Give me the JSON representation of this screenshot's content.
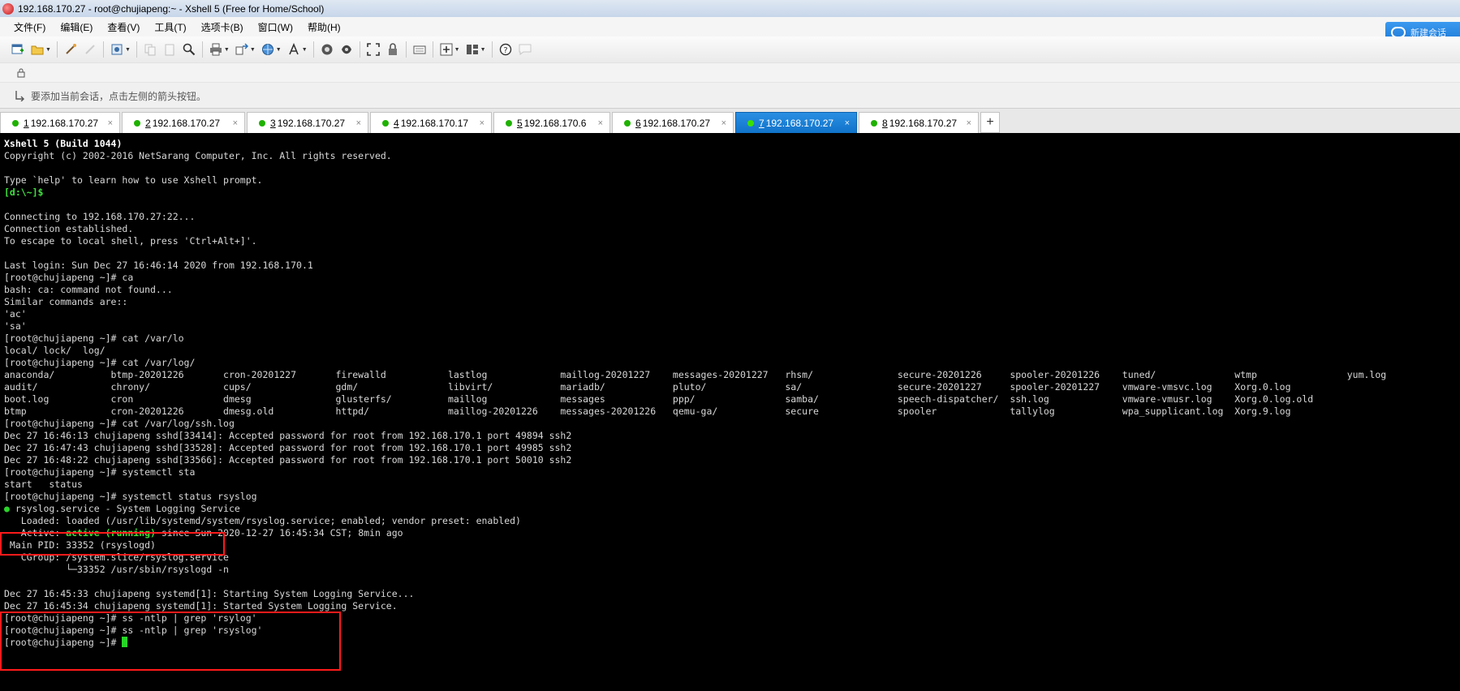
{
  "window": {
    "title": "192.168.170.27 - root@chujiapeng:~ - Xshell 5 (Free for Home/School)"
  },
  "menu": [
    "文件(F)",
    "编辑(E)",
    "查看(V)",
    "工具(T)",
    "选项卡(B)",
    "窗口(W)",
    "帮助(H)"
  ],
  "cloud_badge": "新建会话",
  "hint": "要添加当前会话，点击左侧的箭头按钮。",
  "tabs": [
    {
      "num": "1",
      "ip": "192.168.170.27",
      "active": false
    },
    {
      "num": "2",
      "ip": "192.168.170.27",
      "active": false
    },
    {
      "num": "3",
      "ip": "192.168.170.27",
      "active": false
    },
    {
      "num": "4",
      "ip": "192.168.170.17",
      "active": false
    },
    {
      "num": "5",
      "ip": "192.168.170.6",
      "active": false
    },
    {
      "num": "6",
      "ip": "192.168.170.27",
      "active": false
    },
    {
      "num": "7",
      "ip": "192.168.170.27",
      "active": true
    },
    {
      "num": "8",
      "ip": "192.168.170.27",
      "active": false
    }
  ],
  "tab_add": "+",
  "tab_close": "×",
  "terminal": {
    "l01": "Xshell 5 (Build 1044)",
    "l02": "Copyright (c) 2002-2016 NetSarang Computer, Inc. All rights reserved.",
    "l03": "",
    "l04": "Type `help' to learn how to use Xshell prompt.",
    "l05": "[d:\\~]$",
    "l06": "",
    "l07": "Connecting to 192.168.170.27:22...",
    "l08": "Connection established.",
    "l09": "To escape to local shell, press 'Ctrl+Alt+]'.",
    "l10": "",
    "l11": "Last login: Sun Dec 27 16:46:14 2020 from 192.168.170.1",
    "l12": "[root@chujiapeng ~]# ca",
    "l13": "bash: ca: command not found...",
    "l14": "Similar commands are::",
    "l15": "'ac'",
    "l16": "'sa'",
    "l17": "[root@chujiapeng ~]# cat /var/lo",
    "l18": "local/ lock/  log/",
    "l19": "[root@chujiapeng ~]# cat /var/log/",
    "l20": "anaconda/          btmp-20201226       cron-20201227       firewalld           lastlog             maillog-20201227    messages-20201227   rhsm/               secure-20201226     spooler-20201226    tuned/              wtmp                yum.log",
    "l21": "audit/             chrony/             cups/               gdm/                libvirt/            mariadb/            pluto/              sa/                 secure-20201227     spooler-20201227    vmware-vmsvc.log    Xorg.0.log",
    "l22": "boot.log           cron                dmesg               glusterfs/          maillog             messages            ppp/                samba/              speech-dispatcher/  ssh.log             vmware-vmusr.log    Xorg.0.log.old",
    "l23": "btmp               cron-20201226       dmesg.old           httpd/              maillog-20201226    messages-20201226   qemu-ga/            secure              spooler             tallylog            wpa_supplicant.log  Xorg.9.log",
    "l24": "[root@chujiapeng ~]# cat /var/log/ssh.log",
    "l25": "Dec 27 16:46:13 chujiapeng sshd[33414]: Accepted password for root from 192.168.170.1 port 49894 ssh2",
    "l26": "Dec 27 16:47:43 chujiapeng sshd[33528]: Accepted password for root from 192.168.170.1 port 49985 ssh2",
    "l27": "Dec 27 16:48:22 chujiapeng sshd[33566]: Accepted password for root from 192.168.170.1 port 50010 ssh2",
    "l28": "[root@chujiapeng ~]# systemctl sta",
    "l29": "start   status",
    "l30": "[root@chujiapeng ~]# systemctl status rsyslog",
    "l31_dot": "●",
    "l31": " rsyslog.service - System Logging Service",
    "l32": "   Loaded: loaded (/usr/lib/systemd/system/rsyslog.service; enabled; vendor preset: enabled)",
    "l33a": "   Active: ",
    "l33b": "active (running)",
    "l33c": " since Sun 2020-12-27 16:45:34 CST; 8min ago",
    "l34": " Main PID: 33352 (rsyslogd)",
    "l35": "   CGroup: /system.slice/rsyslog.service",
    "l36": "           └─33352 /usr/sbin/rsyslogd -n",
    "l37": "",
    "l38": "Dec 27 16:45:33 chujiapeng systemd[1]: Starting System Logging Service...",
    "l39": "Dec 27 16:45:34 chujiapeng systemd[1]: Started System Logging Service.",
    "l40": "[root@chujiapeng ~]# ss -ntlp | grep 'rsylog'",
    "l41": "[root@chujiapeng ~]# ss -ntlp | grep 'rsyslog'",
    "l42": "[root@chujiapeng ~]# "
  }
}
